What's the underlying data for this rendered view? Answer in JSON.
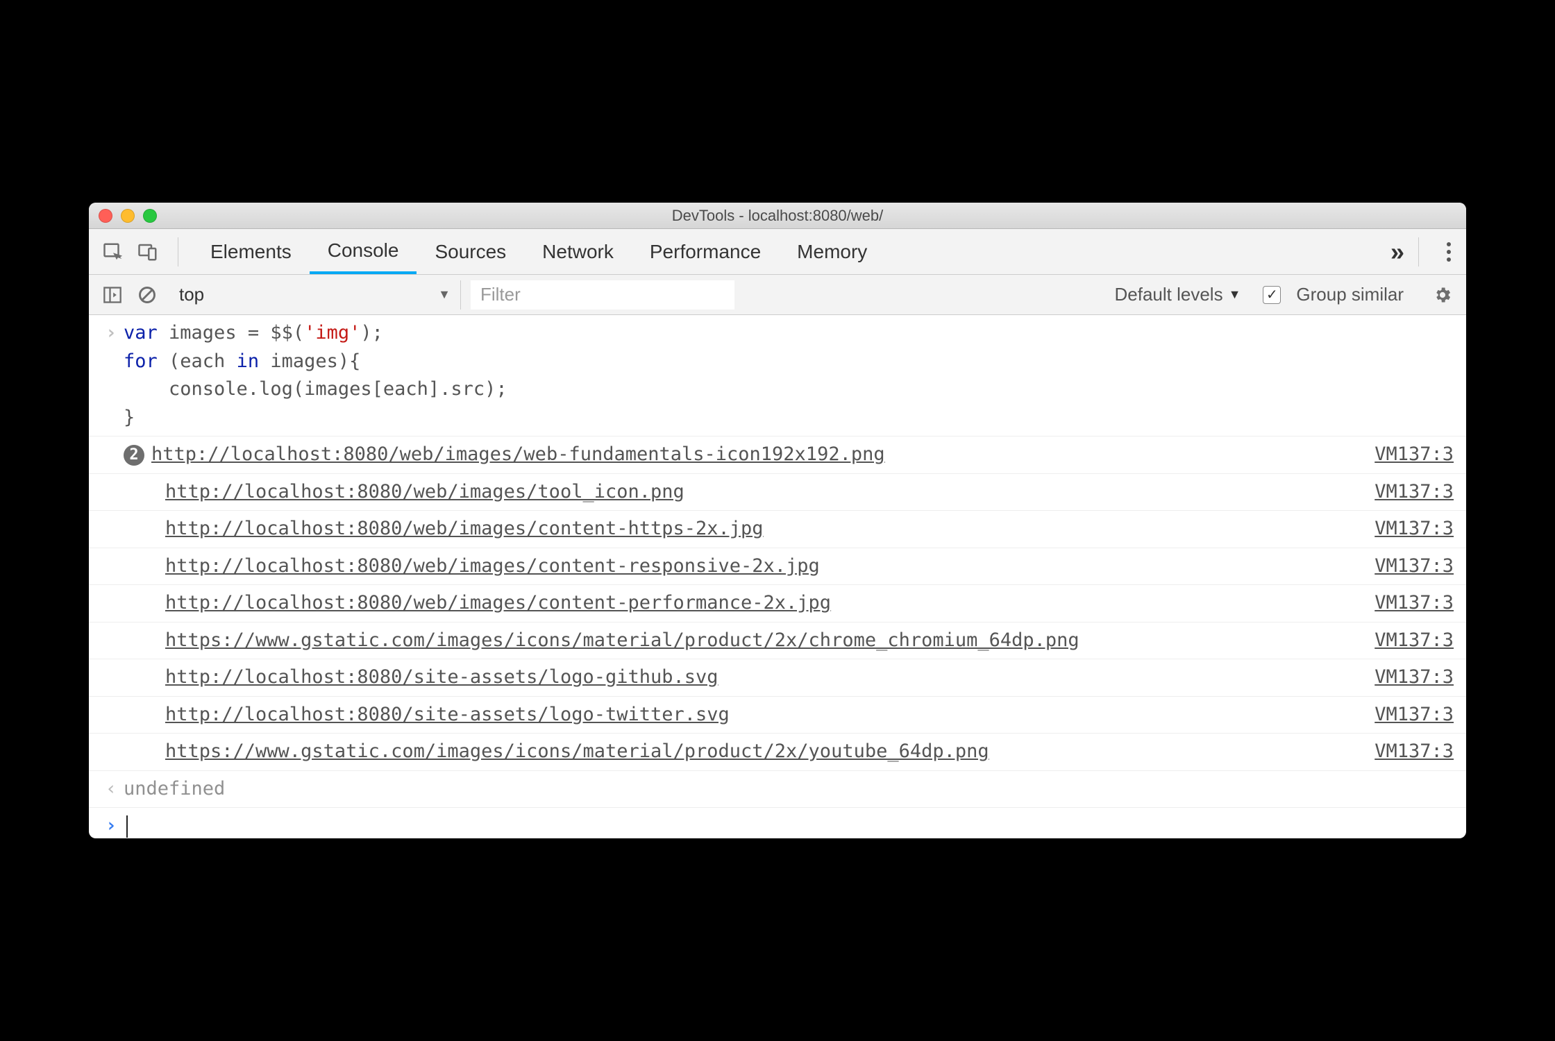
{
  "window": {
    "title": "DevTools - localhost:8080/web/"
  },
  "tabs": {
    "items": [
      "Elements",
      "Console",
      "Sources",
      "Network",
      "Performance",
      "Memory"
    ],
    "active_index": 1
  },
  "toolbar": {
    "context": "top",
    "filter_placeholder": "Filter",
    "levels_label": "Default levels",
    "group_similar_label": "Group similar",
    "group_similar_checked": true
  },
  "input_code": {
    "l1a": "var",
    "l1b": " images = $$(",
    "l1c": "'img'",
    "l1d": ");",
    "l2a": "for",
    "l2b": " (each ",
    "l2c": "in",
    "l2d": " images){",
    "l3": "    console.log(images[each].src);",
    "l4": "}"
  },
  "logs": [
    {
      "badge": "2",
      "url": "http://localhost:8080/web/images/web-fundamentals-icon192x192.png",
      "source": "VM137:3"
    },
    {
      "url": "http://localhost:8080/web/images/tool_icon.png",
      "source": "VM137:3"
    },
    {
      "url": "http://localhost:8080/web/images/content-https-2x.jpg",
      "source": "VM137:3"
    },
    {
      "url": "http://localhost:8080/web/images/content-responsive-2x.jpg",
      "source": "VM137:3"
    },
    {
      "url": "http://localhost:8080/web/images/content-performance-2x.jpg",
      "source": "VM137:3"
    },
    {
      "url": "https://www.gstatic.com/images/icons/material/product/2x/chrome_chromium_64dp.png",
      "source": "VM137:3"
    },
    {
      "url": "http://localhost:8080/site-assets/logo-github.svg",
      "source": "VM137:3"
    },
    {
      "url": "http://localhost:8080/site-assets/logo-twitter.svg",
      "source": "VM137:3"
    },
    {
      "url": "https://www.gstatic.com/images/icons/material/product/2x/youtube_64dp.png",
      "source": "VM137:3"
    }
  ],
  "return_value": "undefined"
}
